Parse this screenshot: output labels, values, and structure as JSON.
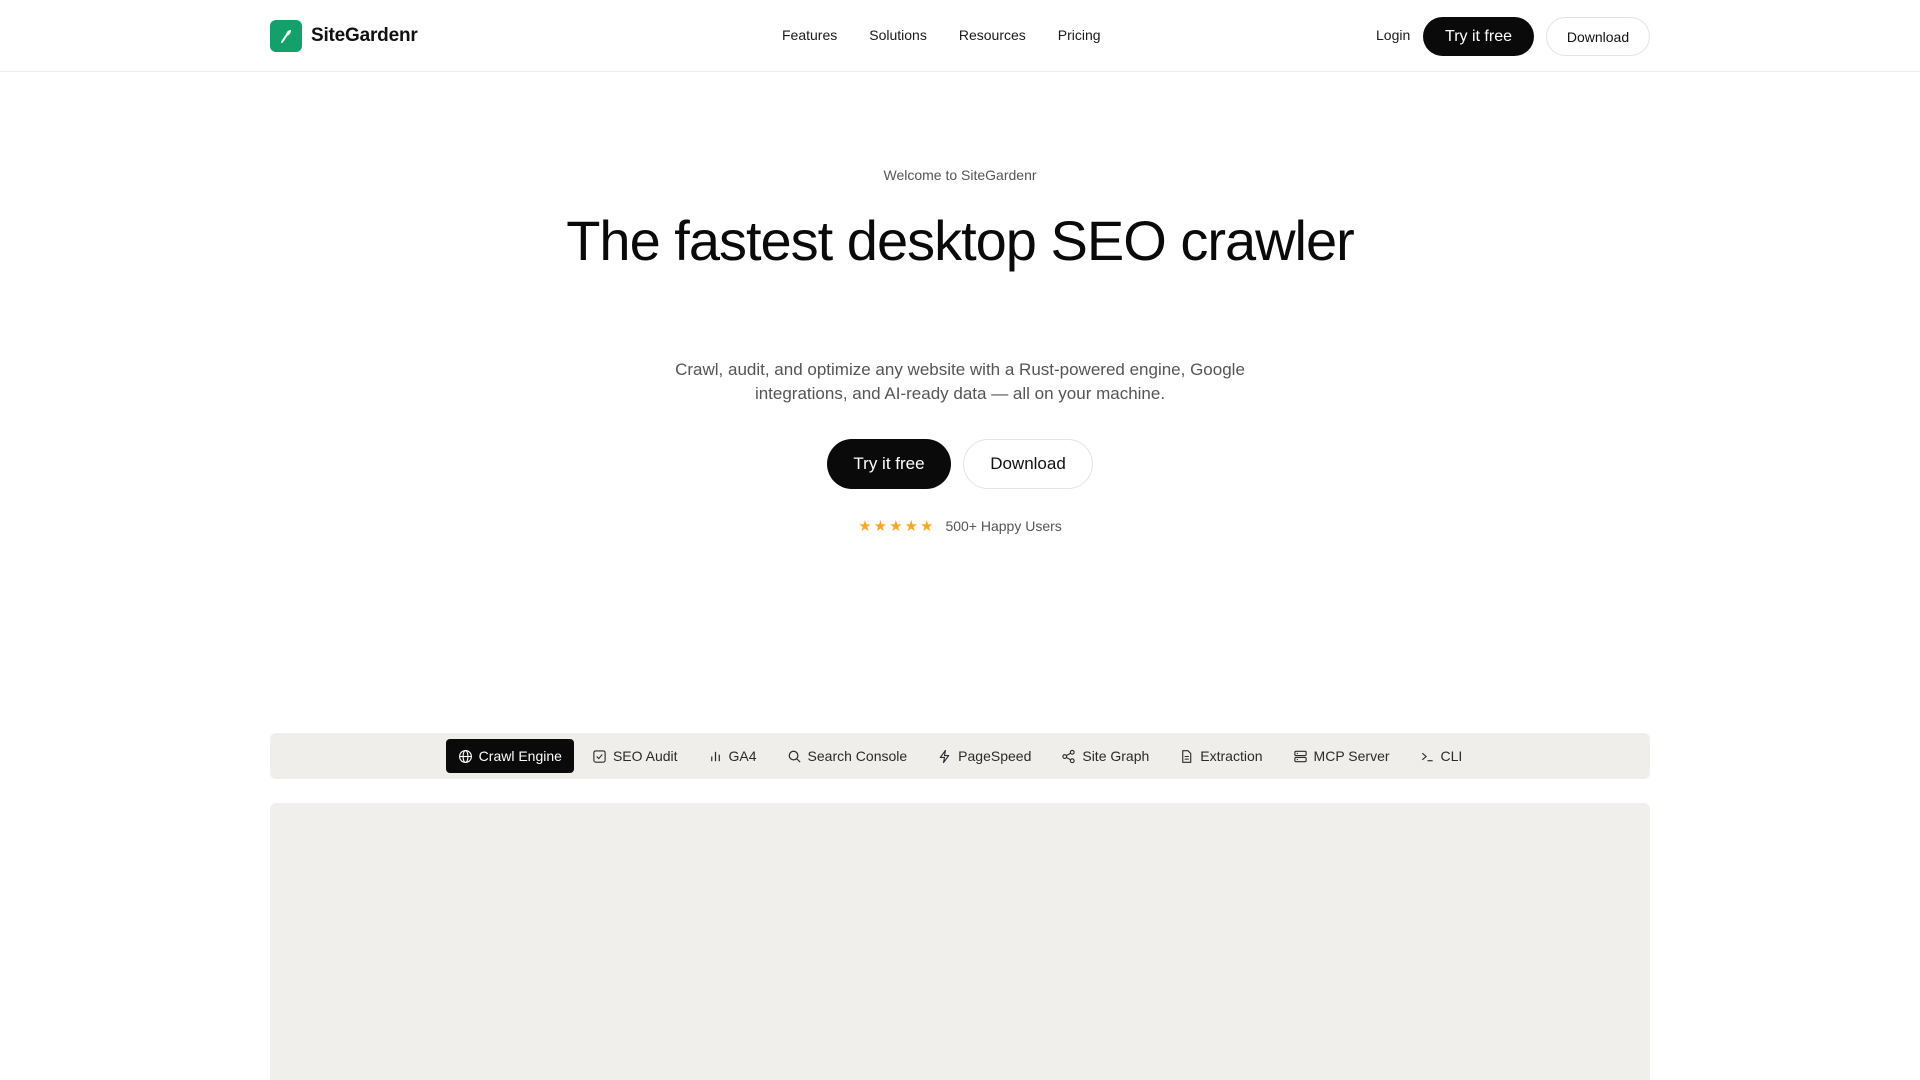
{
  "header": {
    "brand": "SiteGardenr",
    "nav": [
      "Features",
      "Solutions",
      "Resources",
      "Pricing"
    ],
    "login": "Login",
    "cta_primary": "Try it free",
    "cta_secondary": "Download"
  },
  "hero": {
    "eyebrow": "Welcome to SiteGardenr",
    "headline": "The fastest desktop SEO crawler",
    "subtext": "Crawl, audit, and optimize any website with a Rust-powered engine, Google integrations, and AI-ready data — all on your machine.",
    "cta_primary": "Try it free",
    "cta_secondary": "Download",
    "rating": {
      "stars": 5,
      "text": "500+ Happy Users"
    }
  },
  "tabs": [
    {
      "label": "Crawl Engine",
      "icon": "globe-icon",
      "active": true
    },
    {
      "label": "SEO Audit",
      "icon": "checkbox-icon",
      "active": false
    },
    {
      "label": "GA4",
      "icon": "bar-chart-icon",
      "active": false
    },
    {
      "label": "Search Console",
      "icon": "search-icon",
      "active": false
    },
    {
      "label": "PageSpeed",
      "icon": "lightning-icon",
      "active": false
    },
    {
      "label": "Site Graph",
      "icon": "share-icon",
      "active": false
    },
    {
      "label": "Extraction",
      "icon": "document-icon",
      "active": false
    },
    {
      "label": "MCP Server",
      "icon": "server-icon",
      "active": false
    },
    {
      "label": "CLI",
      "icon": "terminal-icon",
      "active": false
    }
  ],
  "colors": {
    "brand": "#13a06a",
    "dark": "#0a0a0a",
    "star": "#f5a623",
    "panel": "#f0efeb"
  }
}
